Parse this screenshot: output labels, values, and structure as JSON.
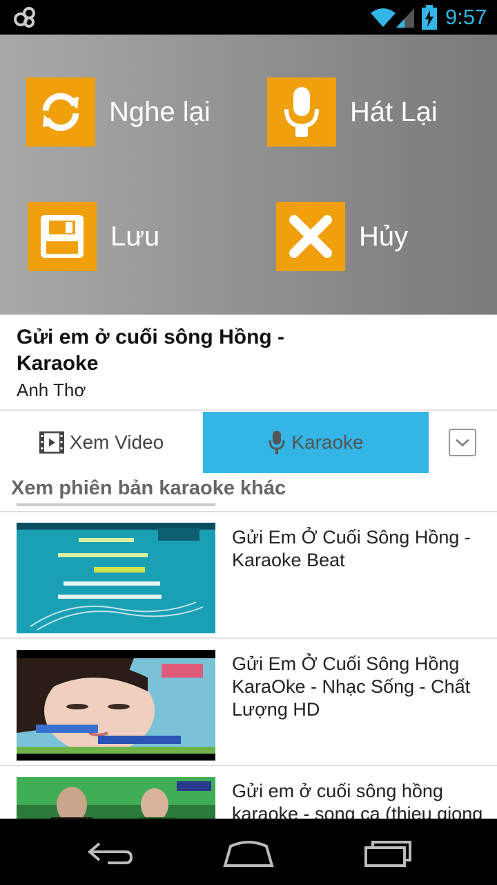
{
  "status_bar": {
    "time": "9:57"
  },
  "actions": {
    "replay": "Nghe lại",
    "sing_again": "Hát Lại",
    "save": "Lưu",
    "cancel": "Hủy"
  },
  "song": {
    "title": "Gửi em ở cuối sông Hồng - Karaoke",
    "artist": "Anh Thơ"
  },
  "tabs": {
    "video": "Xem Video",
    "karaoke": "Karaoke"
  },
  "section_header": "Xem phiên bản karaoke khác",
  "videos": [
    {
      "title": "Gửi Em Ở Cuối Sông Hồng - Karaoke Beat"
    },
    {
      "title": "Gửi Em Ở Cuối Sông Hồng KaraOke - Nhạc Sống - Chất Lượng HD"
    },
    {
      "title": "Gửi em ở cuối sông hồng karaoke - song ca (thieu giong"
    }
  ],
  "colors": {
    "accent_orange": "#f0a00c",
    "accent_blue": "#33b5e5"
  }
}
